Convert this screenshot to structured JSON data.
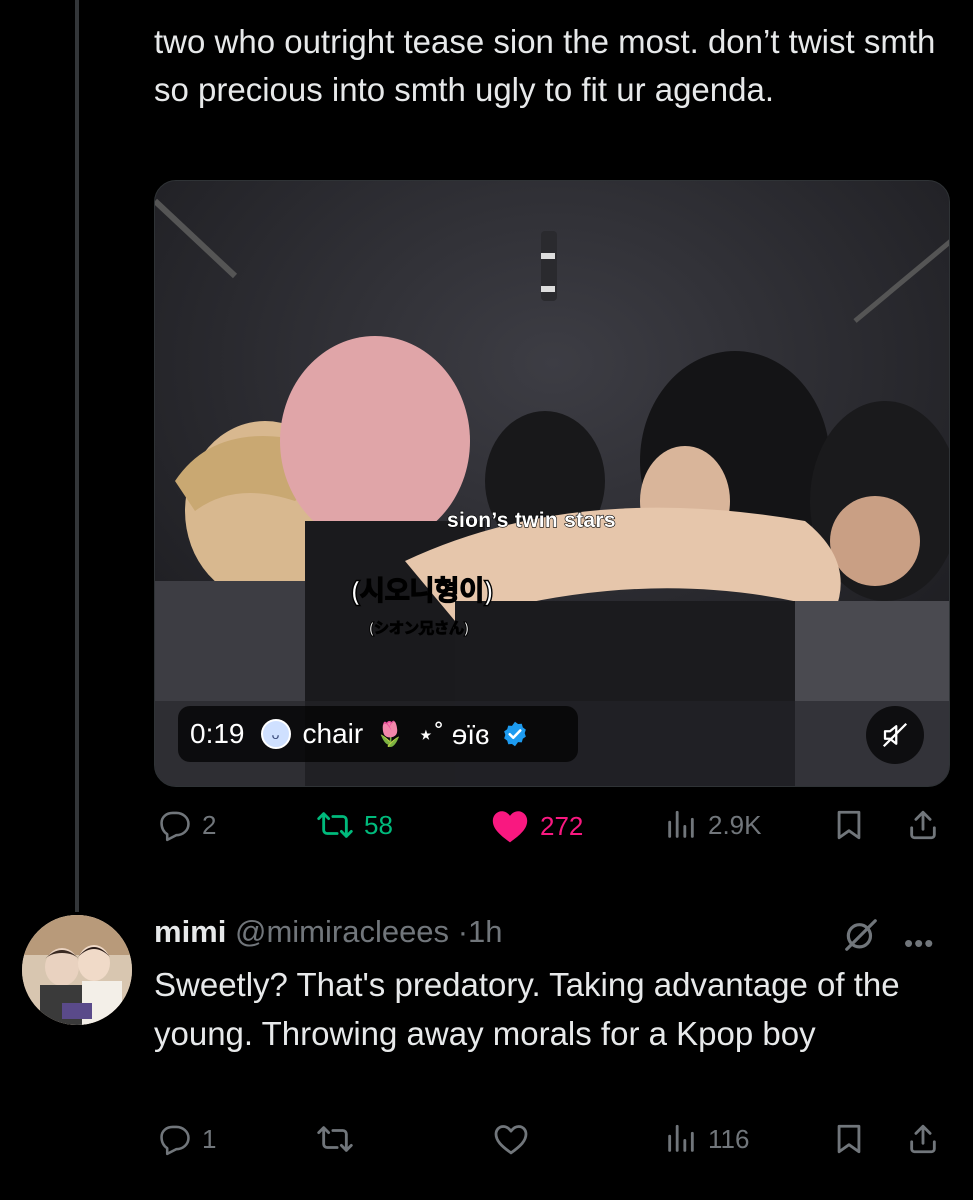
{
  "tweet1": {
    "text": "two who outright tease sion the most. don’t twist smth so precious into smth ugly to fit ur agenda.",
    "video": {
      "caption_en": "sion’s twin stars",
      "caption_ko": "(시오니형이)",
      "caption_jp": "(シオン兄さん)",
      "time": "0:19",
      "author_name": "chair",
      "author_suffix": "⋆˚ ɘïɞ",
      "tulip": "🌷",
      "mute_icon": "speaker-muted-icon"
    },
    "actions": {
      "replies": "2",
      "retweets": "58",
      "likes": "272",
      "views": "2.9K",
      "retweet_color": "#00ba7c",
      "like_color": "#f91880"
    }
  },
  "tweet2": {
    "name": "mimi",
    "handle": "@mimiracleees",
    "dot": "·",
    "time": "1h",
    "text": "Sweetly? That's predatory. Taking advantage of the young. Throwing away morals for a Kpop boy",
    "actions": {
      "replies": "1",
      "retweets": "",
      "likes": "",
      "views": "116"
    }
  },
  "colors": {
    "background": "#000000",
    "text": "#e7e9ea",
    "muted": "#71767b",
    "verified": "#1d9bf0"
  }
}
